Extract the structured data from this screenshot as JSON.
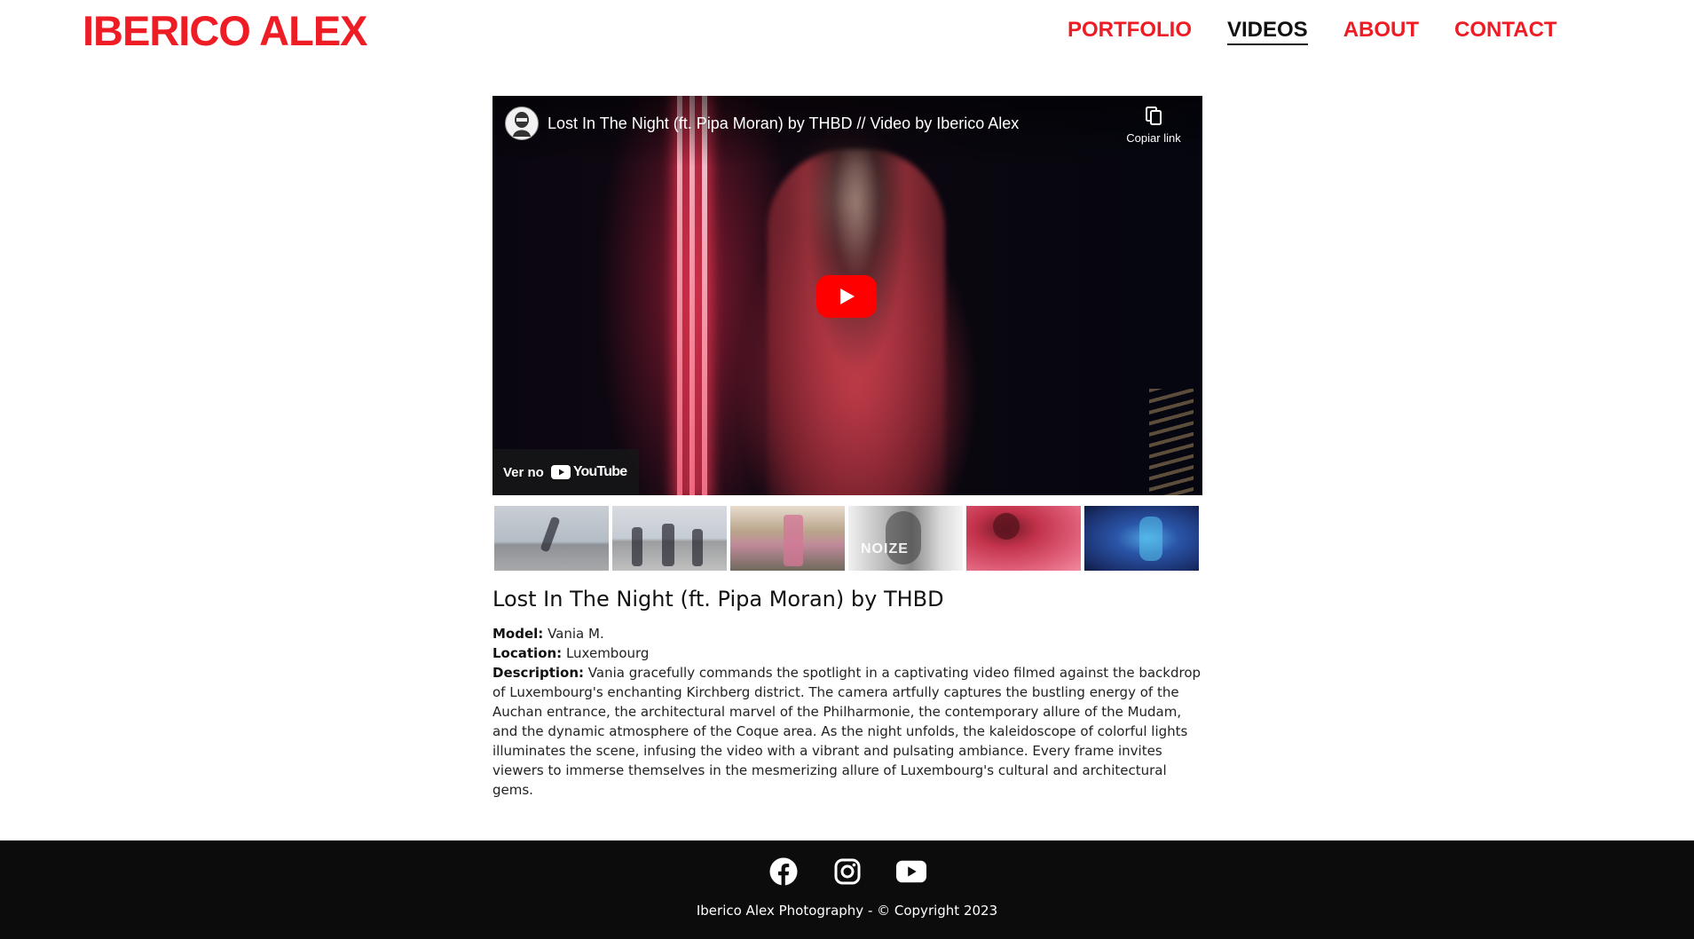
{
  "site": {
    "logo": "IBERICO ALEX",
    "brand_color": "#ee1c25"
  },
  "nav": {
    "items": [
      {
        "label": "PORTFOLIO",
        "active": false
      },
      {
        "label": "VIDEOS",
        "active": true
      },
      {
        "label": "ABOUT",
        "active": false
      },
      {
        "label": "CONTACT",
        "active": false
      }
    ]
  },
  "player": {
    "title": "Lost In The Night (ft. Pipa Moran) by THBD // Video by Iberico Alex",
    "copy_link_label": "Copiar link",
    "watch_on_label": "Ver no",
    "youtube_wordmark": "YouTube",
    "play_button_color": "#ff0000"
  },
  "thumbnails": [
    {
      "icon": "thumbnail-1"
    },
    {
      "icon": "thumbnail-2"
    },
    {
      "icon": "thumbnail-3"
    },
    {
      "icon": "thumbnail-4",
      "overlay_text": "NOIZE"
    },
    {
      "icon": "thumbnail-5"
    },
    {
      "icon": "thumbnail-6"
    }
  ],
  "video": {
    "heading": "Lost In The Night (ft. Pipa Moran) by THBD",
    "model_label": "Model:",
    "model_value": "Vania M.",
    "location_label": "Location:",
    "location_value": "Luxembourg",
    "description_label": "Description:",
    "description_value": "Vania gracefully commands the spotlight in a captivating video filmed against the backdrop of Luxembourg's enchanting Kirchberg district. The camera artfully captures the bustling energy of the Auchan entrance, the architectural marvel of the Philharmonie, the contemporary allure of the Mudam, and the dynamic atmosphere of the Coque area. As the night unfolds, the kaleidoscope of colorful lights illuminates the scene, infusing the video with a vibrant and pulsating ambiance. Every frame invites viewers to immerse themselves in the mesmerizing allure of Luxembourg's cultural and architectural gems."
  },
  "footer": {
    "social_icons": [
      "facebook-icon",
      "instagram-icon",
      "youtube-icon"
    ],
    "copyright": "Iberico Alex Photography - © Copyright 2023",
    "background": "#0c0c0c"
  }
}
